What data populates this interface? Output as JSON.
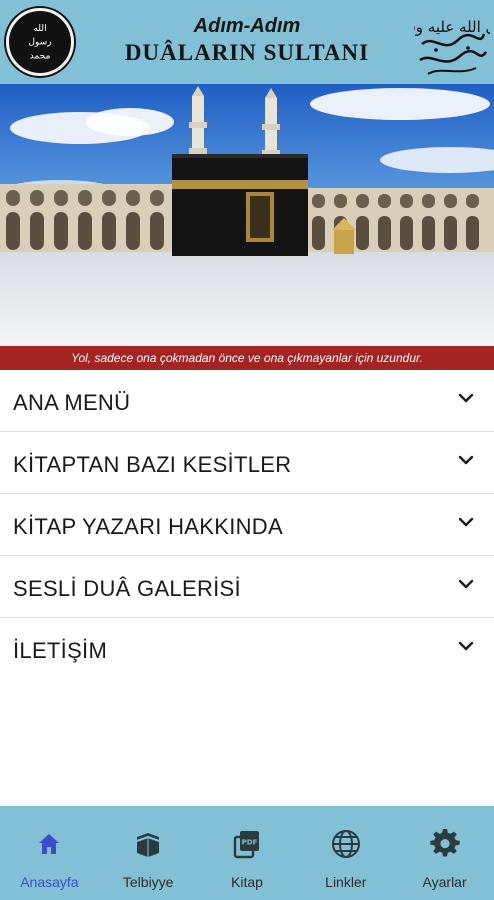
{
  "header": {
    "subtitle": "Adım-Adım",
    "title": "DUÂLARIN SULTANI",
    "seal_text": [
      "الله",
      "رسول",
      "محمد"
    ],
    "calligraphy_text": "صلى الله عليه وسلم"
  },
  "banner": {
    "slides": 3,
    "active_slide": 1
  },
  "quote": "Yol, sadece ona çokmadan önce ve ona çıkmayanlar için uzundur.",
  "menu": {
    "items": [
      {
        "label": "ANA MENÜ",
        "icon": "chevron-down-icon"
      },
      {
        "label": "KİTAPTAN BAZI KESİTLER",
        "icon": "chevron-down-icon"
      },
      {
        "label": "KİTAP YAZARI HAKKINDA",
        "icon": "chevron-down-icon"
      },
      {
        "label": "SESLİ DUÂ GALERİSİ",
        "icon": "chevron-down-icon"
      },
      {
        "label": "İLETİŞİM",
        "icon": "chevron-down-icon"
      }
    ]
  },
  "bottom_nav": {
    "items": [
      {
        "label": "Anasayfa",
        "icon": "home-icon",
        "active": true
      },
      {
        "label": "Telbiyye",
        "icon": "kaaba-icon",
        "active": false
      },
      {
        "label": "Kitap",
        "icon": "pdf-icon",
        "active": false
      },
      {
        "label": "Linkler",
        "icon": "globe-icon",
        "active": false
      },
      {
        "label": "Ayarlar",
        "icon": "gear-icon",
        "active": false
      }
    ]
  },
  "colors": {
    "header_bg": "#82c0d6",
    "quote_bg": "#a42323",
    "active_nav": "#3a4fd0",
    "active_dot": "#a52222"
  }
}
